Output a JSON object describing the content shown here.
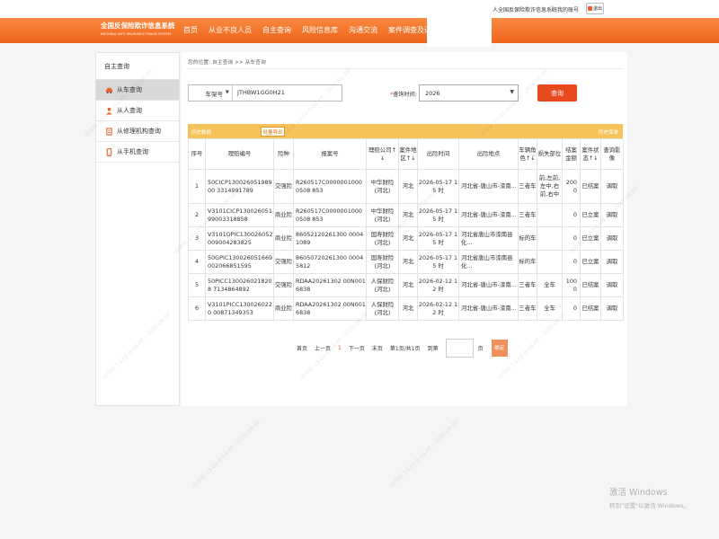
{
  "topbar": {
    "system_name": "人全国反保险欺诈信息系统",
    "separator": "|",
    "my_account": "我的账号",
    "exit_label": "退出"
  },
  "header": {
    "logo_cn": "全国反保险欺诈信息系统",
    "logo_en": "NATIONAL ANTI INSURANCE FRAUD SYSTEM",
    "nav": [
      "首页",
      "从业不良人员",
      "自主查询",
      "风险信息库",
      "沟通交流",
      "案件调查及追偿"
    ]
  },
  "sidebar": {
    "title": "自主查询",
    "items": [
      {
        "label": "从车查询",
        "icon": "car-icon"
      },
      {
        "label": "从人查询",
        "icon": "person-icon"
      },
      {
        "label": "从修理机构查询",
        "icon": "repair-icon"
      },
      {
        "label": "从手机查询",
        "icon": "phone-icon"
      }
    ]
  },
  "breadcrumb": "您的位置: 自主查询 >> 从车查询",
  "search": {
    "field_type": "车架号",
    "field_value": "JTHBW1GG0H21",
    "time_label": "查询时间:",
    "required_mark": "*",
    "year": "2026",
    "query_button": "查询"
  },
  "table": {
    "bar_left": "历史数据",
    "export_button": "批量导出",
    "bar_right": "历史保单",
    "headers": [
      "序号",
      "理赔编号",
      "险种",
      "报案号",
      "理赔公司↑↓",
      "案件地区↑↓",
      "出险时间",
      "出险地点",
      "车辆角色↑↓",
      "损失部位",
      "结案金额",
      "案件状态↑↓",
      "查询影像"
    ],
    "rows": [
      [
        "1",
        "50CICP13002605198900 3314991789",
        "交强险",
        "R260517C00000010000508 853",
        "中华财险 (河北)",
        "河北",
        "2026-05-17 15 时",
        "河北省-唐山市-滦南...",
        "三者车",
        "前,左前,左中,右前,右中",
        "2000",
        "已结案",
        "调取"
      ],
      [
        "2",
        "V3101CICP130026051 99003318858",
        "商业险",
        "R260517C00000010000508 853",
        "中华财险 (河北)",
        "河北",
        "2026-05-17 15 时",
        "河北省-唐山市-滦南...",
        "三者车",
        "",
        "0",
        "已立案",
        "调取"
      ],
      [
        "3",
        "V3101GPIC130026052 009004283825",
        "商业险",
        "86052120261300 00041089",
        "国寿财险 (河北)",
        "河北",
        "2026-05-17 15 时",
        "河北省唐山市滦南县化...",
        "标的车",
        "",
        "0",
        "已立案",
        "调取"
      ],
      [
        "4",
        "50GPIC130026051669 002066851595",
        "交强险",
        "86050720261300 00045812",
        "国寿财险 (河北)",
        "河北",
        "2026-05-17 15 时",
        "河北省唐山市滦南县化...",
        "标的车",
        "",
        "0",
        "已立案",
        "调取"
      ],
      [
        "5",
        "50PICC1300260218208 7134864892",
        "交强险",
        "RDAA20261302 00N0016838",
        "人保财险 (河北)",
        "河北",
        "2026-02-12 12 时",
        "河北省-唐山市-滦南...",
        "三者车",
        "全车",
        "1000",
        "已结案",
        "调取"
      ],
      [
        "6",
        "V3101PICC1300260220 00871349353",
        "商业险",
        "RDAA20261302 00N0016838",
        "人保财险 (河北)",
        "河北",
        "2026-02-12 12 时",
        "河北省-唐山市-滦南...",
        "三者车",
        "全车",
        "0",
        "已结案",
        "调取"
      ]
    ]
  },
  "pager": {
    "first": "首页",
    "prev": "上一页",
    "current": "1",
    "next": "下一页",
    "last": "末页",
    "info": "第1页/共1页",
    "goto_label": "到第",
    "page_unit": "页",
    "go_button": "确定"
  },
  "watermark": "中华财 13-02-0-04-FP - 2026-06-04",
  "windows": {
    "line1": "激活 Windows",
    "line2": "转到\"设置\"以激活 Windows。"
  }
}
